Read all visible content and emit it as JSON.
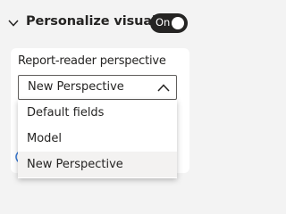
{
  "section": {
    "title": "Personalize visual",
    "collapse_icon": "chevron-down-icon",
    "toggle": {
      "label": "On",
      "state": "on"
    }
  },
  "perspective": {
    "label": "Report-reader perspective",
    "selected": "New Perspective",
    "dropdown_icon": "chevron-up-icon",
    "options": [
      {
        "label": "Default fields"
      },
      {
        "label": "Model"
      },
      {
        "label": "New Perspective"
      }
    ],
    "hovered_option": "New Perspective"
  },
  "colors": {
    "panel_background": "#f3f3f3",
    "card_background": "#ffffff",
    "text": "#252423",
    "toggle_background": "#252423",
    "option_hover": "#f3f2f1",
    "edge_fragment": "#3a7bd5"
  }
}
